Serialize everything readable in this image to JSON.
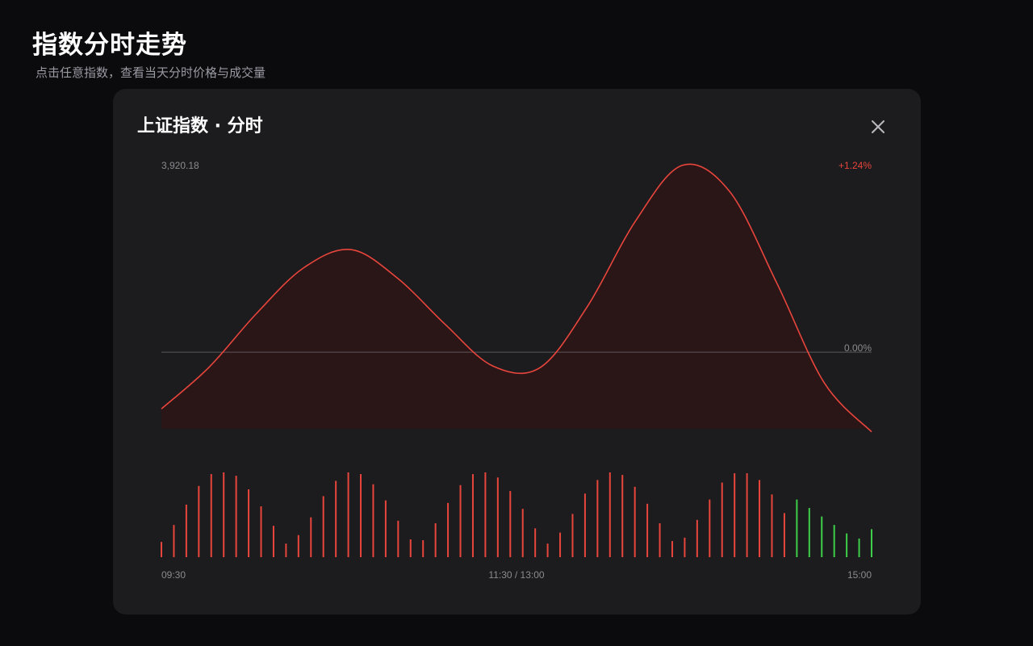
{
  "page": {
    "title": "指数分时走势",
    "subtitle": "点击任意指数，查看当天分时价格与成交量"
  },
  "modal": {
    "title": "上证指数 · 分时",
    "close_icon": "close-icon"
  },
  "colors": {
    "up": "#e8453c",
    "down": "#3ecf4a",
    "area_fill": "#2b1617",
    "baseline": "#8a8a90",
    "label": "#8a8a90"
  },
  "chart_data": {
    "type": "line",
    "price_label_top": "3,920.18",
    "change_label_top": "+1.24%",
    "change_label_baseline": "0.00%",
    "x_tick_labels": [
      "09:30",
      "11:30 / 13:00",
      "15:00"
    ],
    "change_pct_range": [
      -0.5,
      1.24
    ],
    "price_change_pct": [
      -0.37,
      -0.1,
      0.25,
      0.55,
      0.67,
      0.48,
      0.18,
      -0.09,
      -0.1,
      0.3,
      0.85,
      1.22,
      1.05,
      0.45,
      -0.2,
      -0.52
    ],
    "volume": [
      0.18,
      0.38,
      0.62,
      0.84,
      0.98,
      1.0,
      0.96,
      0.8,
      0.6,
      0.37,
      0.16,
      0.26,
      0.47,
      0.72,
      0.9,
      1.0,
      0.98,
      0.86,
      0.67,
      0.43,
      0.21,
      0.2,
      0.4,
      0.64,
      0.85,
      0.98,
      1.0,
      0.94,
      0.78,
      0.57,
      0.34,
      0.16,
      0.29,
      0.51,
      0.75,
      0.91,
      1.0,
      0.97,
      0.83,
      0.63,
      0.4,
      0.19,
      0.23,
      0.44,
      0.68,
      0.88,
      0.99,
      0.99,
      0.91,
      0.74,
      0.52,
      0.68,
      0.58,
      0.48,
      0.38,
      0.28,
      0.22,
      0.33
    ],
    "volume_up_down": [
      "up",
      "up",
      "up",
      "up",
      "up",
      "up",
      "up",
      "up",
      "up",
      "up",
      "up",
      "up",
      "up",
      "up",
      "up",
      "up",
      "up",
      "up",
      "up",
      "up",
      "up",
      "up",
      "up",
      "up",
      "up",
      "up",
      "up",
      "up",
      "up",
      "up",
      "up",
      "up",
      "up",
      "up",
      "up",
      "up",
      "up",
      "up",
      "up",
      "up",
      "up",
      "up",
      "up",
      "up",
      "up",
      "up",
      "up",
      "up",
      "up",
      "up",
      "up",
      "down",
      "down",
      "down",
      "down",
      "down",
      "down",
      "down"
    ]
  }
}
